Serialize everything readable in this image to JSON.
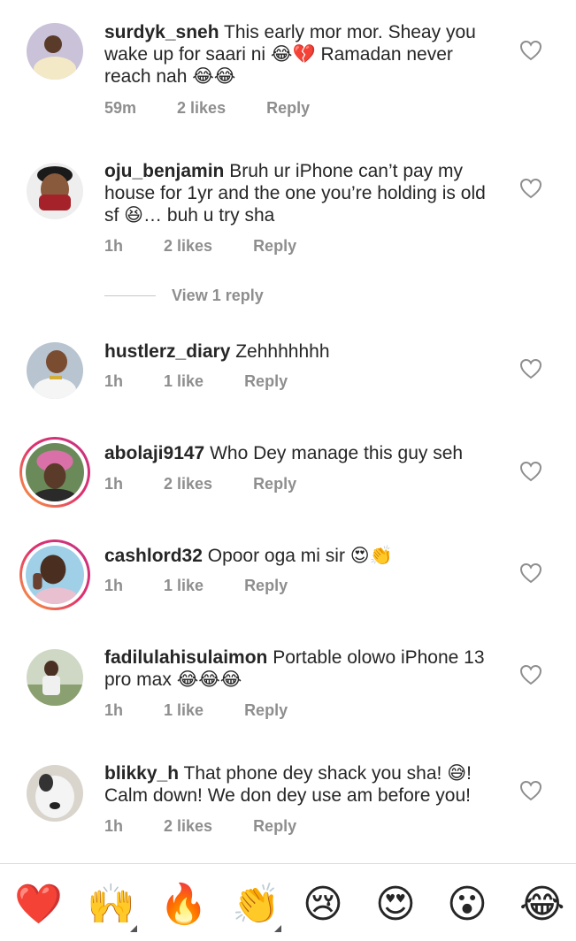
{
  "comments": [
    {
      "username": "surdyk_sneh",
      "text": "This early mor mor. Sheay you wake up for saari ni 😂💔 Ramadan never reach nah 😂😂",
      "time": "59m",
      "likes": "2 likes",
      "reply": "Reply"
    },
    {
      "username": "oju_benjamin",
      "text": "Bruh ur iPhone can’t pay my house for 1yr and the one you’re holding is old sf 😆… buh u try sha",
      "time": "1h",
      "likes": "2 likes",
      "reply": "Reply"
    },
    {
      "username": "hustlerz_diary",
      "text": "Zehhhhhhh",
      "time": "1h",
      "likes": "1 like",
      "reply": "Reply"
    },
    {
      "username": "abolaji9147",
      "text": "Who Dey manage this guy seh",
      "time": "1h",
      "likes": "2 likes",
      "reply": "Reply"
    },
    {
      "username": "cashlord32",
      "text": "Opoor oga mi sir 😍👏",
      "time": "1h",
      "likes": "1 like",
      "reply": "Reply"
    },
    {
      "username": "fadilulahisulaimon",
      "text": "Portable olowo iPhone 13 pro max 😂😂😂",
      "time": "1h",
      "likes": "1 like",
      "reply": "Reply"
    },
    {
      "username": "blikky_h",
      "text": "That phone dey shack you sha! 😅! Calm down! We don dey use am before you!",
      "time": "1h",
      "likes": "2 likes",
      "reply": "Reply"
    }
  ],
  "view_replies": "View 1 reply",
  "emoji_bar": [
    "❤️",
    "🙌",
    "🔥",
    "👏",
    "😢",
    "😍",
    "😮",
    "😂"
  ],
  "colors": {
    "muted": "#8e8e8e",
    "text": "#262626",
    "story_ring_start": "#f9a33b",
    "story_ring_end": "#c13584"
  }
}
